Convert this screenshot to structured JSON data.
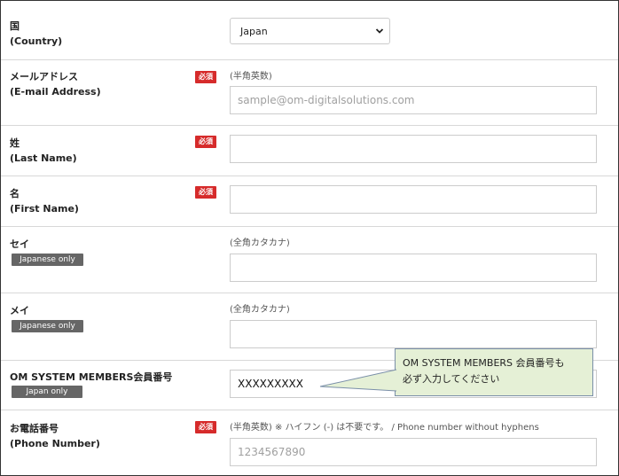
{
  "required_label": "必須",
  "country": {
    "label_ja": "国",
    "label_en": "(Country)",
    "selected": "Japan"
  },
  "email": {
    "label_ja": "メールアドレス",
    "label_en": "(E-mail Address)",
    "hint": "(半角英数)",
    "placeholder": "sample@om-digitalsolutions.com"
  },
  "last_name": {
    "label_ja": "姓",
    "label_en": "(Last Name)"
  },
  "first_name": {
    "label_ja": "名",
    "label_en": "(First Name)"
  },
  "sei": {
    "label": "セイ",
    "badge": "Japanese only",
    "hint": "(全角カタカナ)"
  },
  "mei": {
    "label": "メイ",
    "badge": "Japanese only",
    "hint": "(全角カタカナ)"
  },
  "member": {
    "label": "OM SYSTEM MEMBERS会員番号",
    "badge": "Japan only",
    "value": "XXXXXXXXX"
  },
  "phone": {
    "label_ja": "お電話番号",
    "label_en": "(Phone Number)",
    "hint": "(半角英数) ※ ハイフン (-) は不要です。 / Phone number without hyphens",
    "placeholder": "1234567890"
  },
  "callout": {
    "line1": "OM SYSTEM MEMBERS 会員番号も",
    "line2": "必ず入力してください"
  },
  "colors": {
    "required_red": "#d62b2b",
    "badge_gray": "#666666",
    "callout_green": "#e5f0d6",
    "callout_border": "#7a8fa8"
  }
}
